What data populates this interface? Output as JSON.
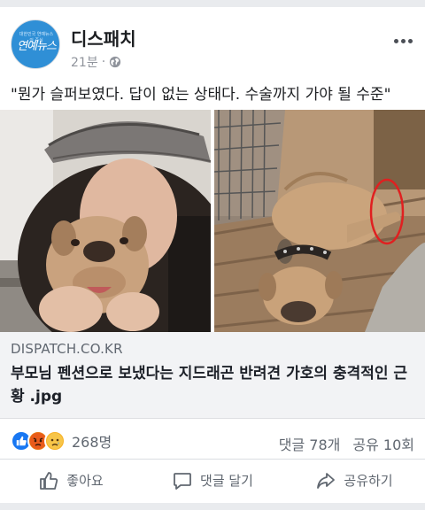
{
  "post": {
    "page_name": "디스패치",
    "time": "21분",
    "dot": "·",
    "avatar_text": "연예뉴스",
    "avatar_sub": "대한민국 연예뉴스의 중심",
    "caption": "\"뭔가 슬퍼보였다. 답이 없는 상태다. 수술까지 가야 될 수준\"",
    "icons": {
      "privacy": "globe-icon",
      "more": "more-options-icon"
    }
  },
  "link": {
    "domain": "DISPATCH.CO.KR",
    "title": "부모님 펜션으로 보냈다는 지드래곤 반려견 가호의 충격적인 근황 .jpg"
  },
  "stats": {
    "reaction_count": "268명",
    "comments": "댓글 78개",
    "shares": "공유 10회",
    "reaction_icons": [
      "like-reaction-icon",
      "angry-reaction-icon",
      "sad-reaction-icon"
    ]
  },
  "actions": {
    "like": "좋아요",
    "comment": "댓글 달기",
    "share": "공유하기"
  },
  "colors": {
    "accent": "#1877f2",
    "highlight_circle": "#e02020"
  }
}
